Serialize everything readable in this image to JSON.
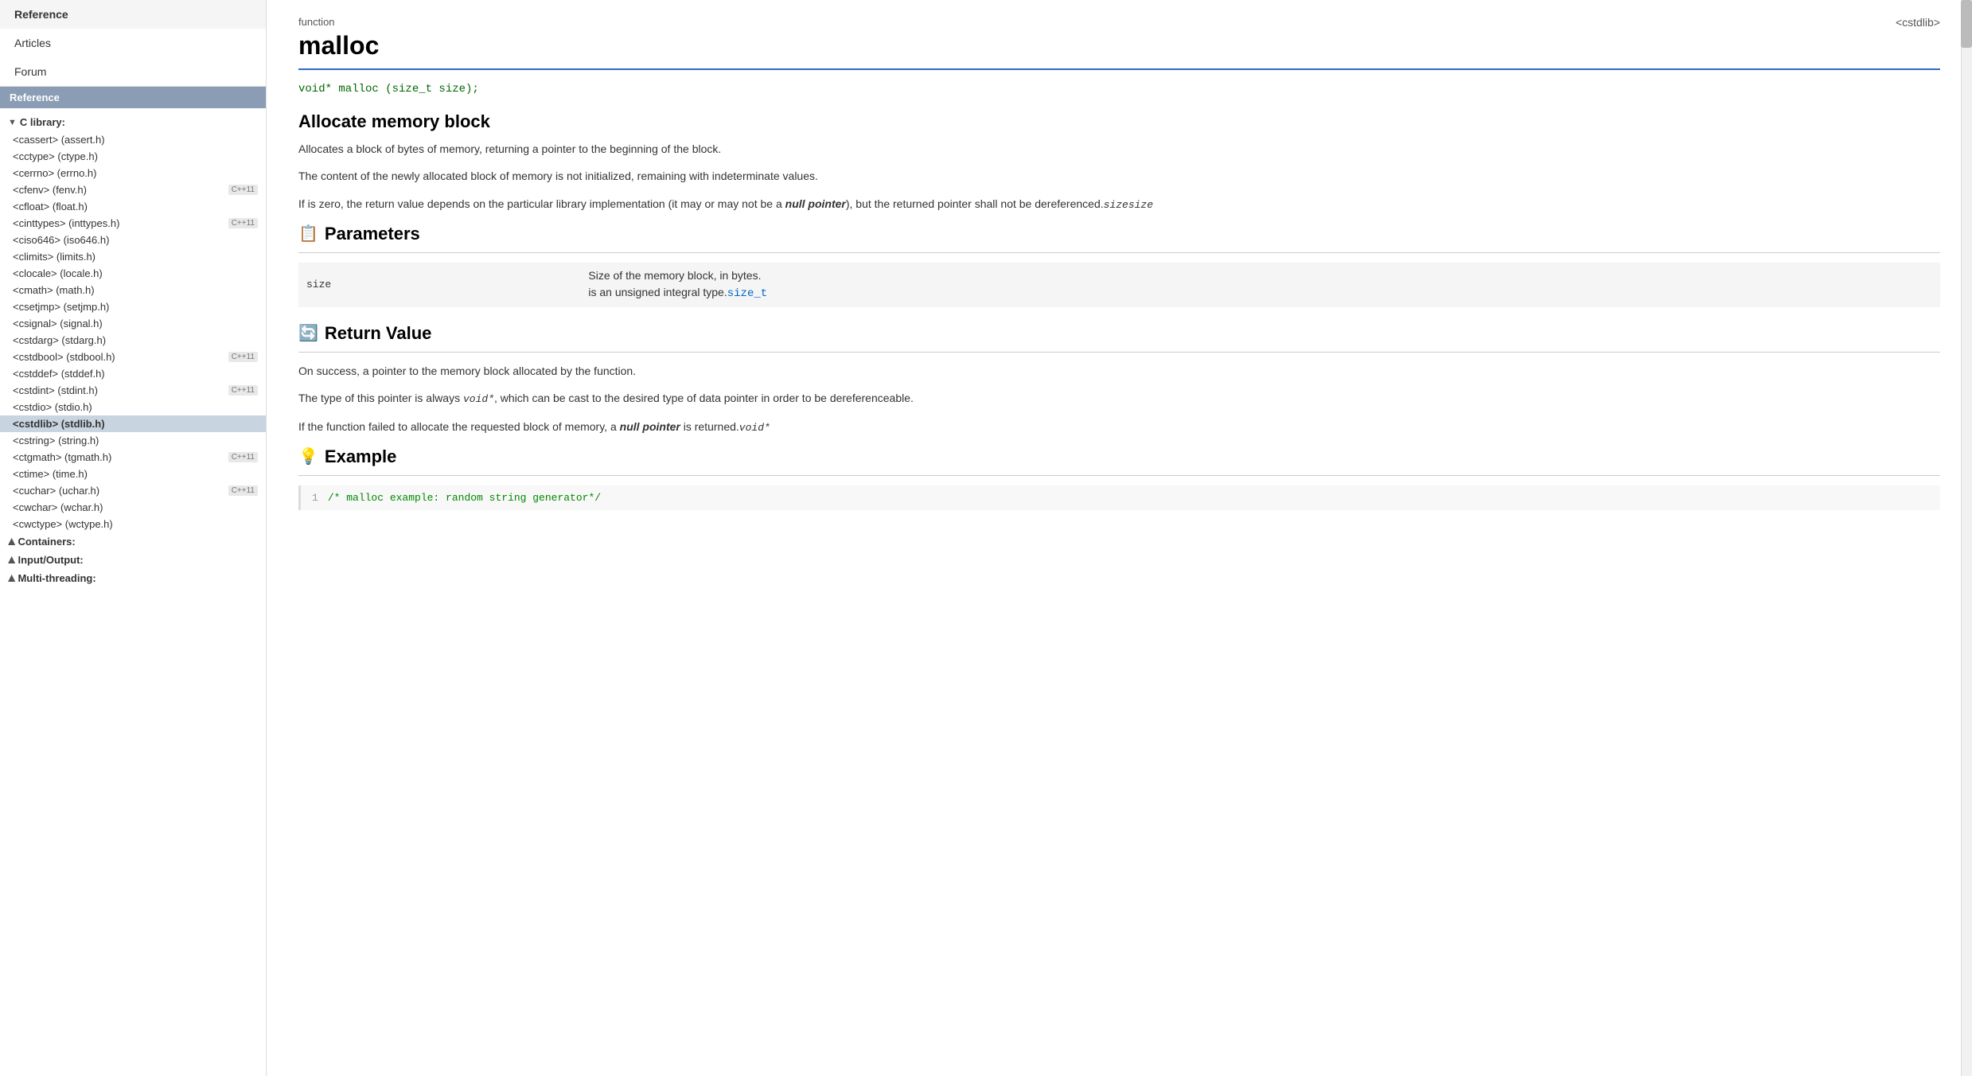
{
  "sidebar": {
    "top_nav": [
      {
        "label": "Reference",
        "active": true
      },
      {
        "label": "Articles",
        "active": false
      },
      {
        "label": "Forum",
        "active": false
      }
    ],
    "section_header": "Reference",
    "tree": {
      "c_library_label": "C library:",
      "c_library_expanded": true,
      "items": [
        {
          "label": "<cassert> (assert.h)",
          "badge": "",
          "active": false
        },
        {
          "label": "<cctype> (ctype.h)",
          "badge": "",
          "active": false
        },
        {
          "label": "<cerrno> (errno.h)",
          "badge": "",
          "active": false
        },
        {
          "label": "<cfenv> (fenv.h)",
          "badge": "C++11",
          "active": false
        },
        {
          "label": "<cfloat> (float.h)",
          "badge": "",
          "active": false
        },
        {
          "label": "<cinttypes> (inttypes.h)",
          "badge": "C++11",
          "active": false
        },
        {
          "label": "<ciso646> (iso646.h)",
          "badge": "",
          "active": false
        },
        {
          "label": "<climits> (limits.h)",
          "badge": "",
          "active": false
        },
        {
          "label": "<clocale> (locale.h)",
          "badge": "",
          "active": false
        },
        {
          "label": "<cmath> (math.h)",
          "badge": "",
          "active": false
        },
        {
          "label": "<csetjmp> (setjmp.h)",
          "badge": "",
          "active": false
        },
        {
          "label": "<csignal> (signal.h)",
          "badge": "",
          "active": false
        },
        {
          "label": "<cstdarg> (stdarg.h)",
          "badge": "",
          "active": false
        },
        {
          "label": "<cstdbool> (stdbool.h)",
          "badge": "C++11",
          "active": false
        },
        {
          "label": "<cstddef> (stddef.h)",
          "badge": "",
          "active": false
        },
        {
          "label": "<cstdint> (stdint.h)",
          "badge": "C++11",
          "active": false
        },
        {
          "label": "<cstdio> (stdio.h)",
          "badge": "",
          "active": false
        },
        {
          "label": "<cstdlib> (stdlib.h)",
          "badge": "",
          "active": true
        },
        {
          "label": "<cstring> (string.h)",
          "badge": "",
          "active": false
        },
        {
          "label": "<ctgmath> (tgmath.h)",
          "badge": "C++11",
          "active": false
        },
        {
          "label": "<ctime> (time.h)",
          "badge": "",
          "active": false
        },
        {
          "label": "<cuchar> (uchar.h)",
          "badge": "C++11",
          "active": false
        },
        {
          "label": "<cwchar> (wchar.h)",
          "badge": "",
          "active": false
        },
        {
          "label": "<cwctype> (wctype.h)",
          "badge": "",
          "active": false
        }
      ],
      "containers_label": "Containers:",
      "io_label": "Input/Output:",
      "multithreading_label": "Multi-threading:"
    }
  },
  "main": {
    "function_label": "function",
    "function_title": "malloc",
    "cstdlib_badge": "<cstdlib>",
    "code_signature": "void* malloc (size_t size);",
    "section_allocate": {
      "title": "Allocate memory block",
      "paragraphs": [
        "Allocates a block of bytes of memory, returning a pointer to the beginning of the block.",
        "The content of the newly allocated block of memory is not initialized, remaining with indeterminate values.",
        "If is zero, the return value depends on the particular library implementation (it may or may not be a null pointer), but the returned pointer shall not be dereferenced."
      ],
      "size_ref": "sizesize"
    },
    "section_parameters": {
      "title": "Parameters",
      "icon": "📋",
      "param_name": "size",
      "param_desc_line1": "Size of the memory block, in bytes.",
      "param_desc_line2": "is an unsigned integral type.",
      "size_t_link": "size_t"
    },
    "section_return": {
      "title": "Return Value",
      "icon": "🔄",
      "lines": [
        "On success, a pointer to the memory block allocated by the function.",
        "The type of this pointer is always , which can be cast to the desired type of data pointer in order to be dereferenceable.",
        "If the function failed to allocate the requested block of memory, a null pointer is returned."
      ],
      "void_star": "void*"
    },
    "section_example": {
      "title": "Example",
      "icon": "💡",
      "code_line1": "/* malloc example: random string generator*/"
    }
  }
}
